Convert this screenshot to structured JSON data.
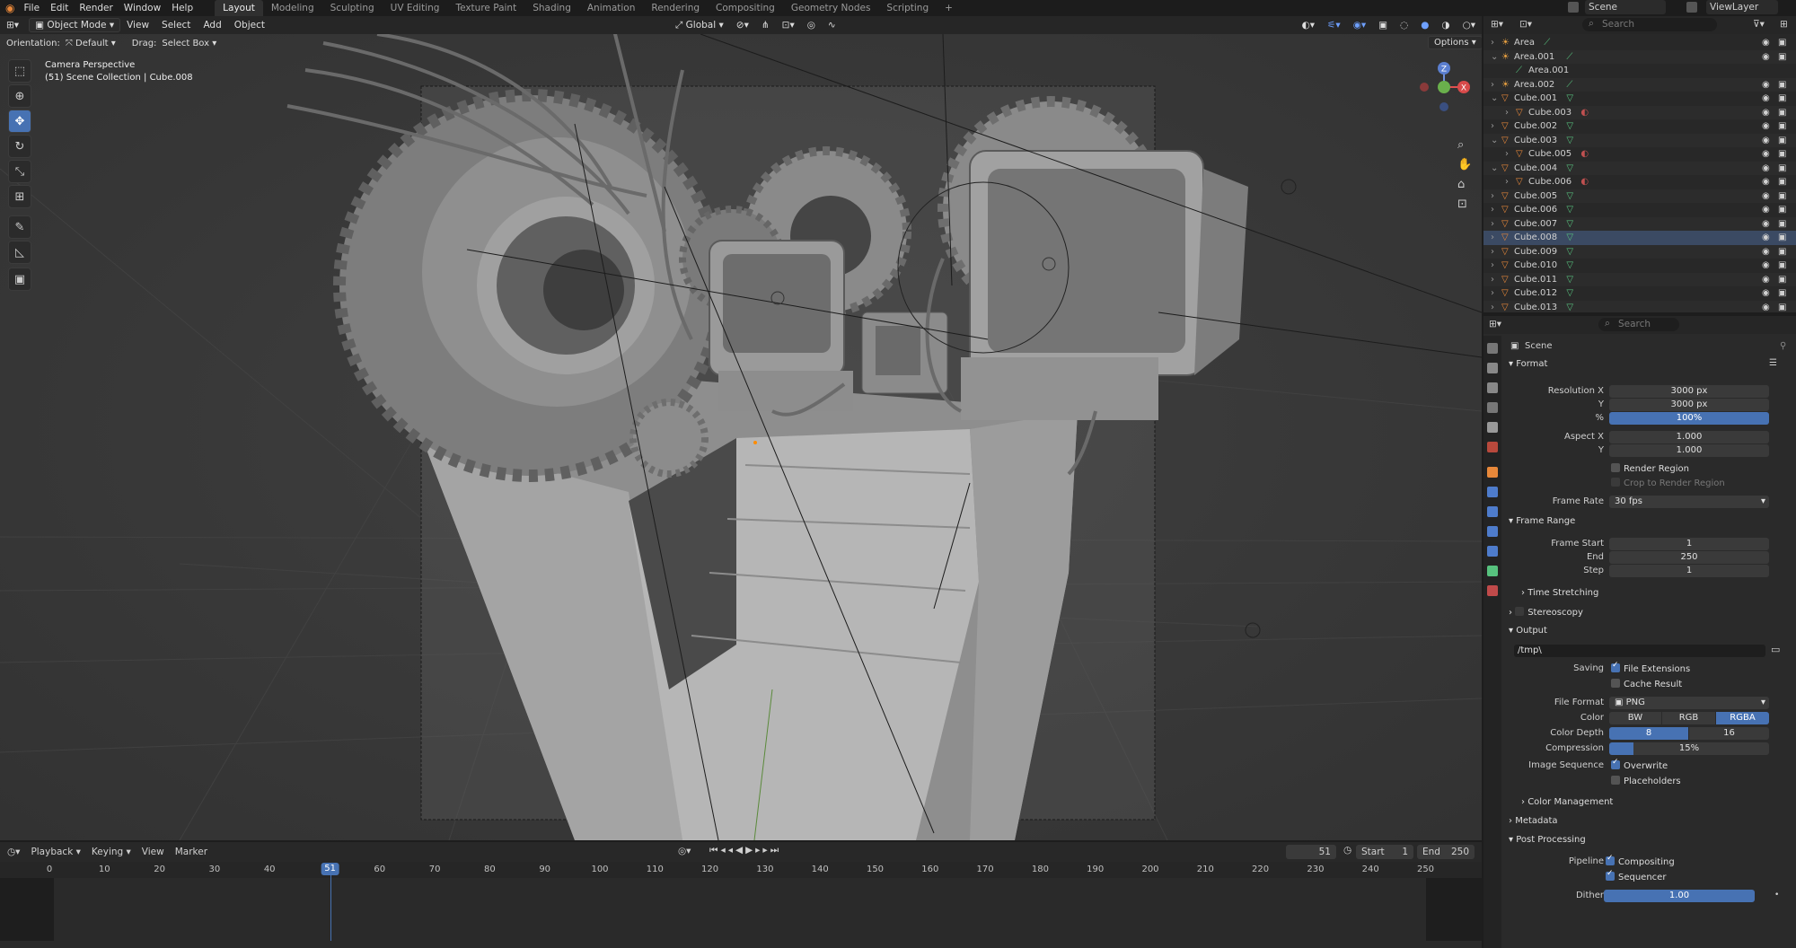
{
  "menu": [
    "File",
    "Edit",
    "Render",
    "Window",
    "Help"
  ],
  "workspaces": [
    "Layout",
    "Modeling",
    "Sculpting",
    "UV Editing",
    "Texture Paint",
    "Shading",
    "Animation",
    "Rendering",
    "Compositing",
    "Geometry Nodes",
    "Scripting"
  ],
  "scene_name": "Scene",
  "view_layer": "ViewLayer",
  "viewport": {
    "mode": "Object Mode",
    "menus": [
      "View",
      "Select",
      "Add",
      "Object"
    ],
    "transform": "Global",
    "orientation_label": "Orientation:",
    "orientation": "Default",
    "drag_label": "Drag:",
    "drag": "Select Box",
    "options": "Options",
    "overlay_title": "Camera Perspective",
    "overlay_sub": "(51) Scene Collection | Cube.008",
    "gizmo_z": "Z",
    "gizmo_x": "X"
  },
  "outliner": {
    "search_placeholder": "Search",
    "rows": [
      {
        "name": "Area",
        "kind": "light",
        "indent": 0
      },
      {
        "name": "Area.001",
        "kind": "light",
        "indent": 0
      },
      {
        "name": "Area.001",
        "kind": "data",
        "indent": 1
      },
      {
        "name": "Area.002",
        "kind": "light",
        "indent": 0
      },
      {
        "name": "Cube.001",
        "kind": "mesh",
        "indent": 0
      },
      {
        "name": "Cube.003",
        "kind": "mesh-child",
        "indent": 1
      },
      {
        "name": "Cube.002",
        "kind": "mesh",
        "indent": 0
      },
      {
        "name": "Cube.003",
        "kind": "mesh",
        "indent": 0
      },
      {
        "name": "Cube.005",
        "kind": "mesh-child",
        "indent": 1
      },
      {
        "name": "Cube.004",
        "kind": "mesh",
        "indent": 0
      },
      {
        "name": "Cube.006",
        "kind": "mesh-child",
        "indent": 1
      },
      {
        "name": "Cube.005",
        "kind": "mesh",
        "indent": 0
      },
      {
        "name": "Cube.006",
        "kind": "mesh",
        "indent": 0
      },
      {
        "name": "Cube.007",
        "kind": "mesh",
        "indent": 0
      },
      {
        "name": "Cube.008",
        "kind": "mesh",
        "indent": 0
      },
      {
        "name": "Cube.009",
        "kind": "mesh",
        "indent": 0
      },
      {
        "name": "Cube.010",
        "kind": "mesh",
        "indent": 0
      },
      {
        "name": "Cube.011",
        "kind": "mesh",
        "indent": 0
      },
      {
        "name": "Cube.012",
        "kind": "mesh",
        "indent": 0
      },
      {
        "name": "Cube.013",
        "kind": "mesh",
        "indent": 0
      }
    ]
  },
  "properties": {
    "search_placeholder": "Search",
    "context": "Scene",
    "format": {
      "title": "Format",
      "res_x_label": "Resolution X",
      "res_x": "3000 px",
      "res_y_label": "Y",
      "res_y": "3000 px",
      "pct_label": "%",
      "pct": "100%",
      "aspect_x_label": "Aspect X",
      "aspect_x": "1.000",
      "aspect_y_label": "Y",
      "aspect_y": "1.000",
      "render_region": "Render Region",
      "crop": "Crop to Render Region",
      "frame_rate_label": "Frame Rate",
      "frame_rate": "30 fps"
    },
    "frame_range": {
      "title": "Frame Range",
      "start_label": "Frame Start",
      "start": "1",
      "end_label": "End",
      "end": "250",
      "step_label": "Step",
      "step": "1",
      "time_stretching": "Time Stretching"
    },
    "stereoscopy": "Stereoscopy",
    "output": {
      "title": "Output",
      "path": "/tmp\\",
      "saving_label": "Saving",
      "file_extensions": "File Extensions",
      "cache_result": "Cache Result",
      "file_format_label": "File Format",
      "file_format": "PNG",
      "color_label": "Color",
      "color_opts": [
        "BW",
        "RGB",
        "RGBA"
      ],
      "depth_label": "Color Depth",
      "depth_opts": [
        "8",
        "16"
      ],
      "compression_label": "Compression",
      "compression": "15%",
      "compression_value": 0.15,
      "image_seq_label": "Image Sequence",
      "overwrite": "Overwrite",
      "placeholders": "Placeholders",
      "color_management": "Color Management"
    },
    "metadata": "Metadata",
    "post": {
      "title": "Post Processing",
      "pipeline_label": "Pipeline",
      "compositing": "Compositing",
      "sequencer": "Sequencer",
      "dither_label": "Dither",
      "dither": "1.00"
    }
  },
  "timeline": {
    "menus": [
      "Playback",
      "Keying",
      "View",
      "Marker"
    ],
    "current_frame": "51",
    "start_label": "Start",
    "start": "1",
    "end_label": "End",
    "end": "250",
    "ticks": [
      "0",
      "10",
      "20",
      "30",
      "40",
      "51",
      "60",
      "70",
      "80",
      "90",
      "100",
      "110",
      "120",
      "130",
      "140",
      "150",
      "160",
      "170",
      "180",
      "190",
      "200",
      "210",
      "220",
      "230",
      "240",
      "250"
    ],
    "playhead_frame": 51
  },
  "colors": {
    "accent": "#4772b3",
    "mesh": "#e8883a",
    "light": "#e8a040",
    "data": "#57c27e"
  }
}
